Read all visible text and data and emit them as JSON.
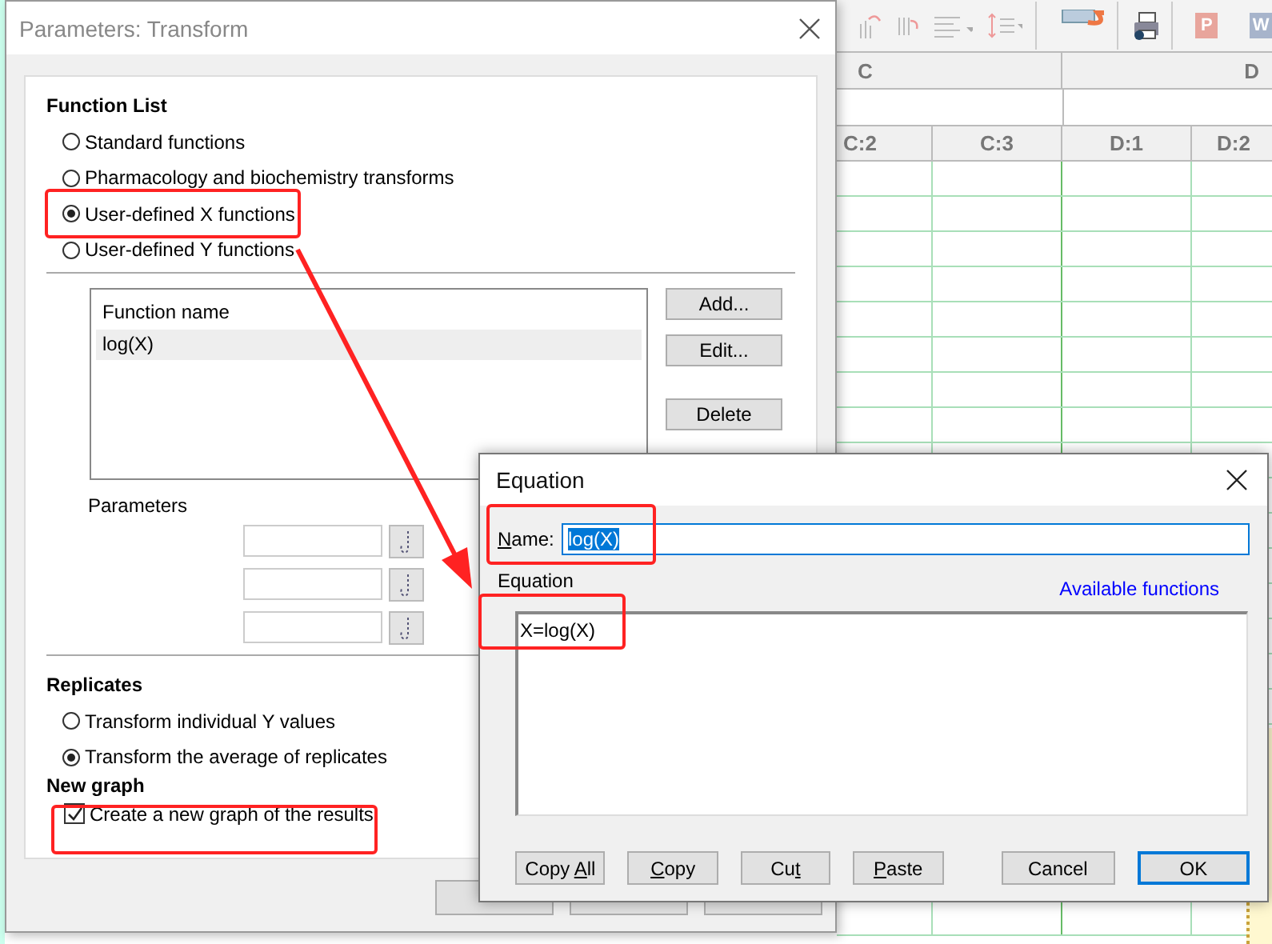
{
  "spreadsheet": {
    "toolbar_badges": [
      "P",
      "W"
    ],
    "column_groups": [
      "C",
      "D"
    ],
    "subcolumns": [
      "C:2",
      "C:3",
      "D:1",
      "D:2"
    ]
  },
  "transform_dialog": {
    "title": "Parameters: Transform",
    "function_list": {
      "heading": "Function List",
      "options": [
        {
          "label": "Standard functions",
          "selected": false
        },
        {
          "label": "Pharmacology and biochemistry transforms",
          "selected": false
        },
        {
          "label": "User-defined X functions",
          "selected": true
        },
        {
          "label": "User-defined Y functions",
          "selected": false
        }
      ]
    },
    "functions_table": {
      "header": "Function name",
      "rows": [
        {
          "name": "log(X)",
          "selected": true
        }
      ]
    },
    "list_buttons": [
      "Add...",
      "Edit...",
      "Delete"
    ],
    "parameters_label": "Parameters",
    "replicates": {
      "heading": "Replicates",
      "options": [
        {
          "label": "Transform individual Y values",
          "selected": false
        },
        {
          "label": "Transform the average of replicates",
          "selected": true
        }
      ]
    },
    "new_graph": {
      "heading": "New graph",
      "label": "Create a new graph of the results",
      "checked": true
    }
  },
  "equation_dialog": {
    "title": "Equation",
    "name_label": {
      "key": "N",
      "after": "ame:"
    },
    "name_value": "log(X)",
    "equation_label": "Equation",
    "link": "Available functions",
    "equation": "X=log(X)",
    "buttons": [
      {
        "before": "Copy ",
        "key": "A",
        "after": "ll",
        "default": false
      },
      {
        "key": "C",
        "after": "opy",
        "default": false
      },
      {
        "before": "Cu",
        "key": "t",
        "default": false
      },
      {
        "key": "P",
        "after": "aste",
        "default": false
      },
      {
        "before": "Cancel",
        "default": false
      },
      {
        "before": "OK",
        "default": true
      }
    ]
  }
}
